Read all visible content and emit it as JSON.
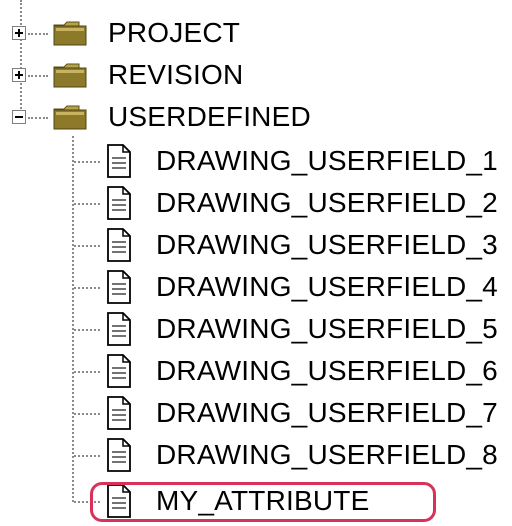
{
  "tree": {
    "nodes": [
      {
        "label": "PROJECT",
        "state": "collapsed"
      },
      {
        "label": "REVISION",
        "state": "collapsed"
      },
      {
        "label": "USERDEFINED",
        "state": "expanded"
      }
    ],
    "children": [
      {
        "label": "DRAWING_USERFIELD_1"
      },
      {
        "label": "DRAWING_USERFIELD_2"
      },
      {
        "label": "DRAWING_USERFIELD_3"
      },
      {
        "label": "DRAWING_USERFIELD_4"
      },
      {
        "label": "DRAWING_USERFIELD_5"
      },
      {
        "label": "DRAWING_USERFIELD_6"
      },
      {
        "label": "DRAWING_USERFIELD_7"
      },
      {
        "label": "DRAWING_USERFIELD_8"
      },
      {
        "label": "MY_ATTRIBUTE"
      }
    ],
    "highlighted": "MY_ATTRIBUTE"
  },
  "colors": {
    "highlight": "#d8325a",
    "folder": "#8c7a2a",
    "connector": "#8a8a8a"
  }
}
